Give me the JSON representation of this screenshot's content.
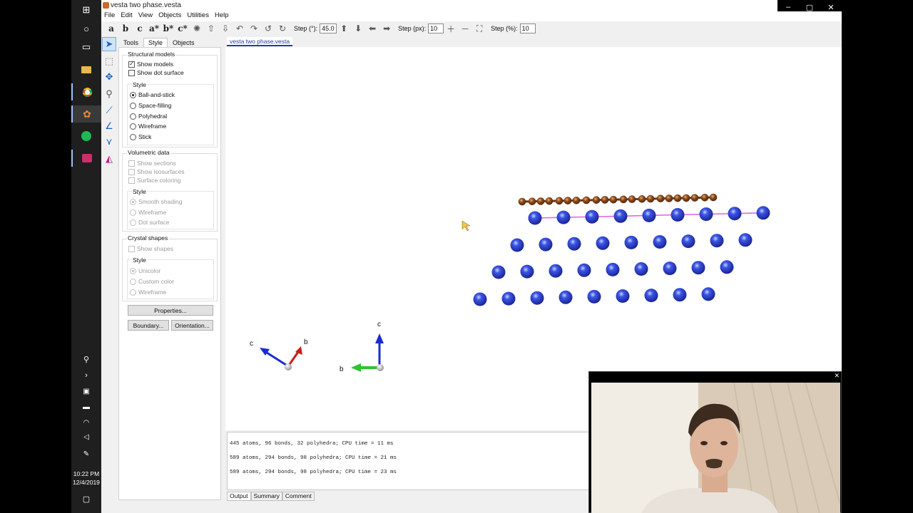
{
  "window": {
    "title": "vesta two phase.vesta",
    "controls": [
      "–",
      "▢",
      "✕"
    ]
  },
  "menu": [
    "File",
    "Edit",
    "View",
    "Objects",
    "Utilities",
    "Help"
  ],
  "toolbar": {
    "axis_buttons": [
      "a",
      "b",
      "c",
      "a*",
      "b*",
      "c*"
    ],
    "step_deg_label": "Step (°):",
    "step_deg_value": "45.0",
    "step_px_label": "Step (px):",
    "step_px_value": "10",
    "step_pct_label": "Step (%):",
    "step_pct_value": "10"
  },
  "side_panel": {
    "tabs": [
      "Tools",
      "Style",
      "Objects"
    ],
    "active_tab": "Style",
    "structural_models": {
      "title": "Structural models",
      "show_models": "Show models",
      "show_dot_surface": "Show dot surface",
      "style_title": "Style",
      "styles": [
        "Ball-and-stick",
        "Space-filling",
        "Polyhedral",
        "Wireframe",
        "Stick"
      ],
      "selected_style": "Ball-and-stick"
    },
    "volumetric_data": {
      "title": "Volumetric data",
      "options": [
        "Show sections",
        "Show isosurfaces",
        "Surface coloring"
      ],
      "style_title": "Style",
      "styles": [
        "Smooth shading",
        "Wireframe",
        "Dot surface"
      ]
    },
    "crystal_shapes": {
      "title": "Crystal shapes",
      "show_shapes": "Show shapes",
      "style_title": "Style",
      "styles": [
        "Unicolor",
        "Custom color",
        "Wireframe"
      ]
    },
    "buttons": {
      "properties": "Properties...",
      "boundary": "Boundary...",
      "orientation": "Orientation..."
    }
  },
  "document_tab": "vesta two phase.vesta",
  "axes_labels": {
    "left_c": "c",
    "left_b": "b",
    "right_c": "c",
    "right_b": "b"
  },
  "output": {
    "lines": [
      "445 atoms, 96 bonds, 32 polyhedra; CPU time = 11 ms",
      "589 atoms, 294 bonds, 98 polyhedra; CPU time = 21 ms",
      "589 atoms, 294 bonds, 98 polyhedra; CPU time = 23 ms"
    ],
    "tabs": [
      "Output",
      "Summary",
      "Comment"
    ]
  },
  "taskbar": {
    "time": "10:22 PM",
    "date": "12/4/2019"
  },
  "colors": {
    "atom_blue": "#2a3fd0",
    "atom_brown": "#8a4a1c",
    "bond_magenta": "#e060e0",
    "accent": "#1e3fa0"
  }
}
